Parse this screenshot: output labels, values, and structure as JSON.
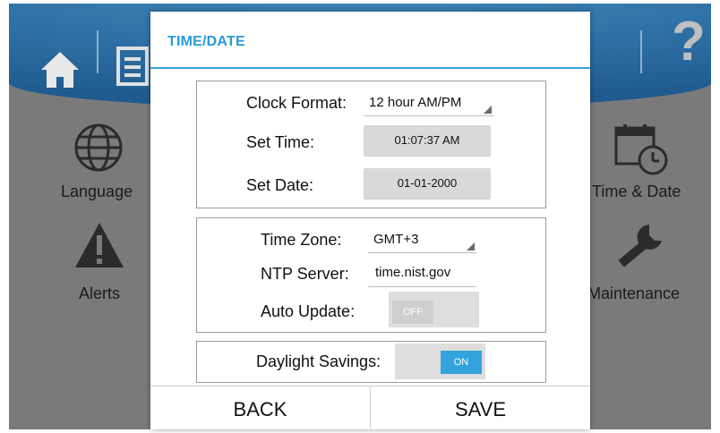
{
  "background": {
    "tiles": [
      {
        "label": "Language",
        "icon": "globe-icon"
      },
      {
        "label": "Alerts",
        "icon": "warning-icon"
      },
      {
        "label": "Time & Date",
        "icon": "calendar-clock-icon"
      },
      {
        "label": "Maintenance",
        "icon": "wrench-icon"
      }
    ],
    "header_icons": [
      "home-icon",
      "settings-list-icon",
      "help-icon"
    ],
    "help_glyph": "?"
  },
  "dialog": {
    "title": "TIME/DATE",
    "clock": {
      "format_label": "Clock Format:",
      "format_value": "12 hour AM/PM",
      "time_label": "Set Time:",
      "time_value": "01:07:37 AM",
      "date_label": "Set Date:",
      "date_value": "01-01-2000"
    },
    "network": {
      "timezone_label": "Time Zone:",
      "timezone_value": "GMT+3",
      "ntp_label": "NTP Server:",
      "ntp_value": "time.nist.gov",
      "auto_update_label": "Auto Update:",
      "auto_update_state": "OFF"
    },
    "dst": {
      "label": "Daylight Savings:",
      "state": "ON"
    },
    "back_label": "BACK",
    "save_label": "SAVE"
  },
  "colors": {
    "accent": "#33a3dc",
    "header_blue": "#2d6fa4",
    "toggle_off": "#cfcfcf",
    "toggle_on": "#33a3dc"
  }
}
